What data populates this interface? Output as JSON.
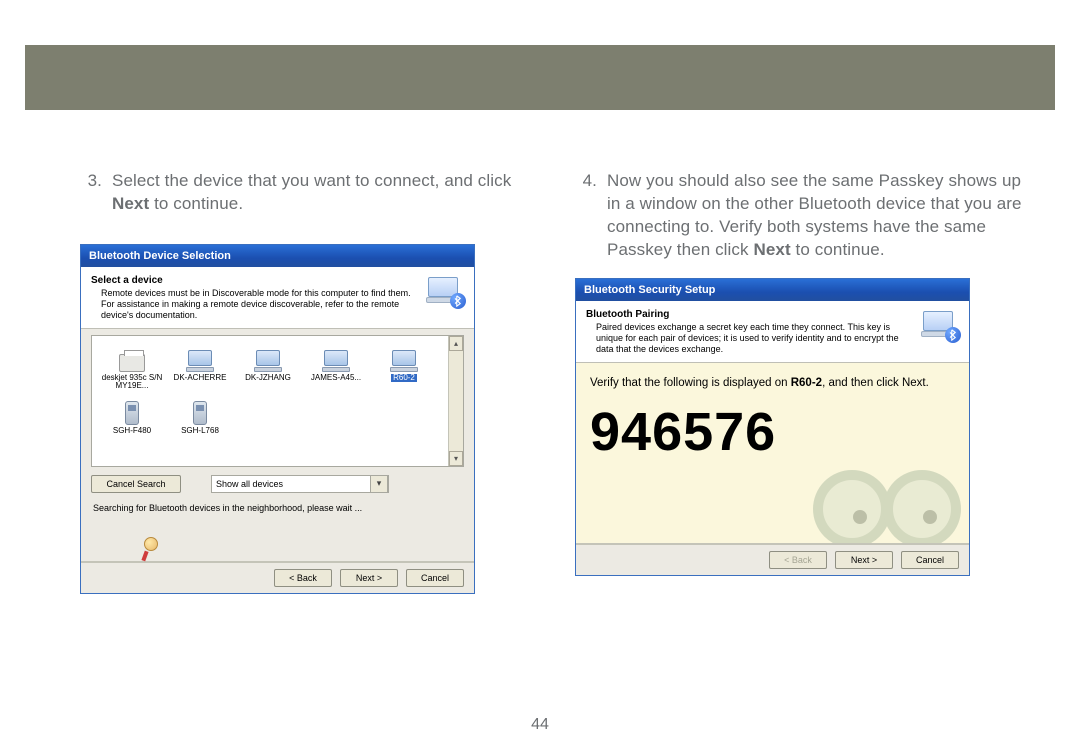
{
  "page_number": "44",
  "left": {
    "step_number": "3.",
    "step_text_before": "Select the device that you want to connect, and click ",
    "step_text_bold": "Next",
    "step_text_after": " to continue.",
    "dialog": {
      "title": "Bluetooth Device Selection",
      "header_title": "Select a device",
      "header_body": "Remote devices must be in Discoverable mode for this computer to find them. For assistance in making a remote device discoverable, refer to the remote device's documentation.",
      "devices": [
        {
          "name": "deskjet 935c S/N MY19E...",
          "type": "printer",
          "selected": false
        },
        {
          "name": "DK-ACHERRE",
          "type": "laptop",
          "selected": false
        },
        {
          "name": "DK-JZHANG",
          "type": "laptop",
          "selected": false
        },
        {
          "name": "JAMES-A45...",
          "type": "laptop",
          "selected": false
        },
        {
          "name": "R60-2",
          "type": "laptop",
          "selected": true
        },
        {
          "name": "SGH-F480",
          "type": "phone",
          "selected": false
        },
        {
          "name": "SGH-L768",
          "type": "phone",
          "selected": false
        }
      ],
      "cancel_search_label": "Cancel Search",
      "filter_label": "Show all devices",
      "status_text": "Searching for Bluetooth devices in the neighborhood, please wait ...",
      "back_label": "< Back",
      "next_label": "Next >",
      "cancel_label": "Cancel"
    }
  },
  "right": {
    "step_number": "4.",
    "step_text_1": "Now you should also see the same Passkey shows up in a window on the other Bluetooth device that you are connecting to.  Verify both systems have the same Passkey then click ",
    "step_text_bold": "Next",
    "step_text_2": " to continue.",
    "dialog": {
      "title": "Bluetooth Security Setup",
      "header_title": "Bluetooth Pairing",
      "header_body": "Paired devices exchange a secret key each time they connect. This key is unique for each pair of devices; it is used to verify identity and to encrypt the data that the devices exchange.",
      "verify_before": "Verify that the following is displayed on ",
      "verify_device": "R60-2",
      "verify_after": ", and then click Next.",
      "passkey": "946576",
      "back_label": "< Back",
      "next_label": "Next >",
      "cancel_label": "Cancel"
    }
  }
}
